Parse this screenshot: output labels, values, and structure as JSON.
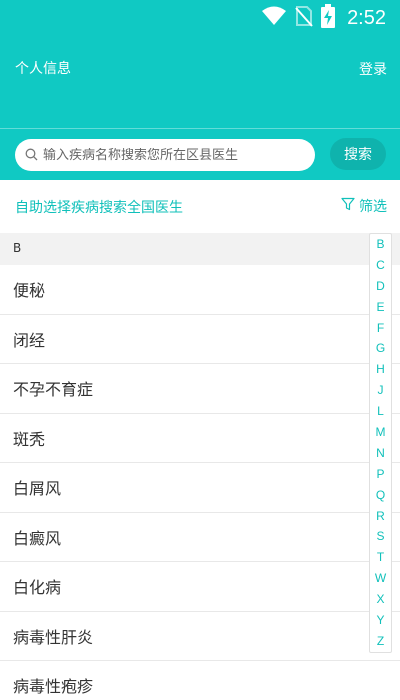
{
  "status_bar": {
    "time": "2:52",
    "icons": [
      "wifi-icon",
      "no-sim-icon",
      "battery-charging-icon"
    ]
  },
  "header": {
    "left_label": "个人信息",
    "right_label": "登录"
  },
  "search": {
    "placeholder": "输入疾病名称搜索您所在区县医生",
    "button_label": "搜索",
    "icon": "search-icon"
  },
  "filter_bar": {
    "left_label": "自助选择疾病搜索全国医生",
    "right_label": "筛选",
    "right_icon": "filter-icon"
  },
  "list": {
    "section_letter": "B",
    "items": [
      "便秘",
      "闭经",
      "不孕不育症",
      "斑秃",
      "白屑风",
      "白癜风",
      "白化病",
      "病毒性肝炎",
      "病毒性疱疹"
    ]
  },
  "index_bar": {
    "letters": [
      "B",
      "C",
      "D",
      "E",
      "F",
      "G",
      "H",
      "J",
      "L",
      "M",
      "N",
      "P",
      "Q",
      "R",
      "S",
      "T",
      "W",
      "X",
      "Y",
      "Z"
    ]
  },
  "colors": {
    "primary": "#10c9c3",
    "button": "#0fb3ad",
    "accent_text": "#10c0ba",
    "section_bg": "#f2f2f2"
  }
}
